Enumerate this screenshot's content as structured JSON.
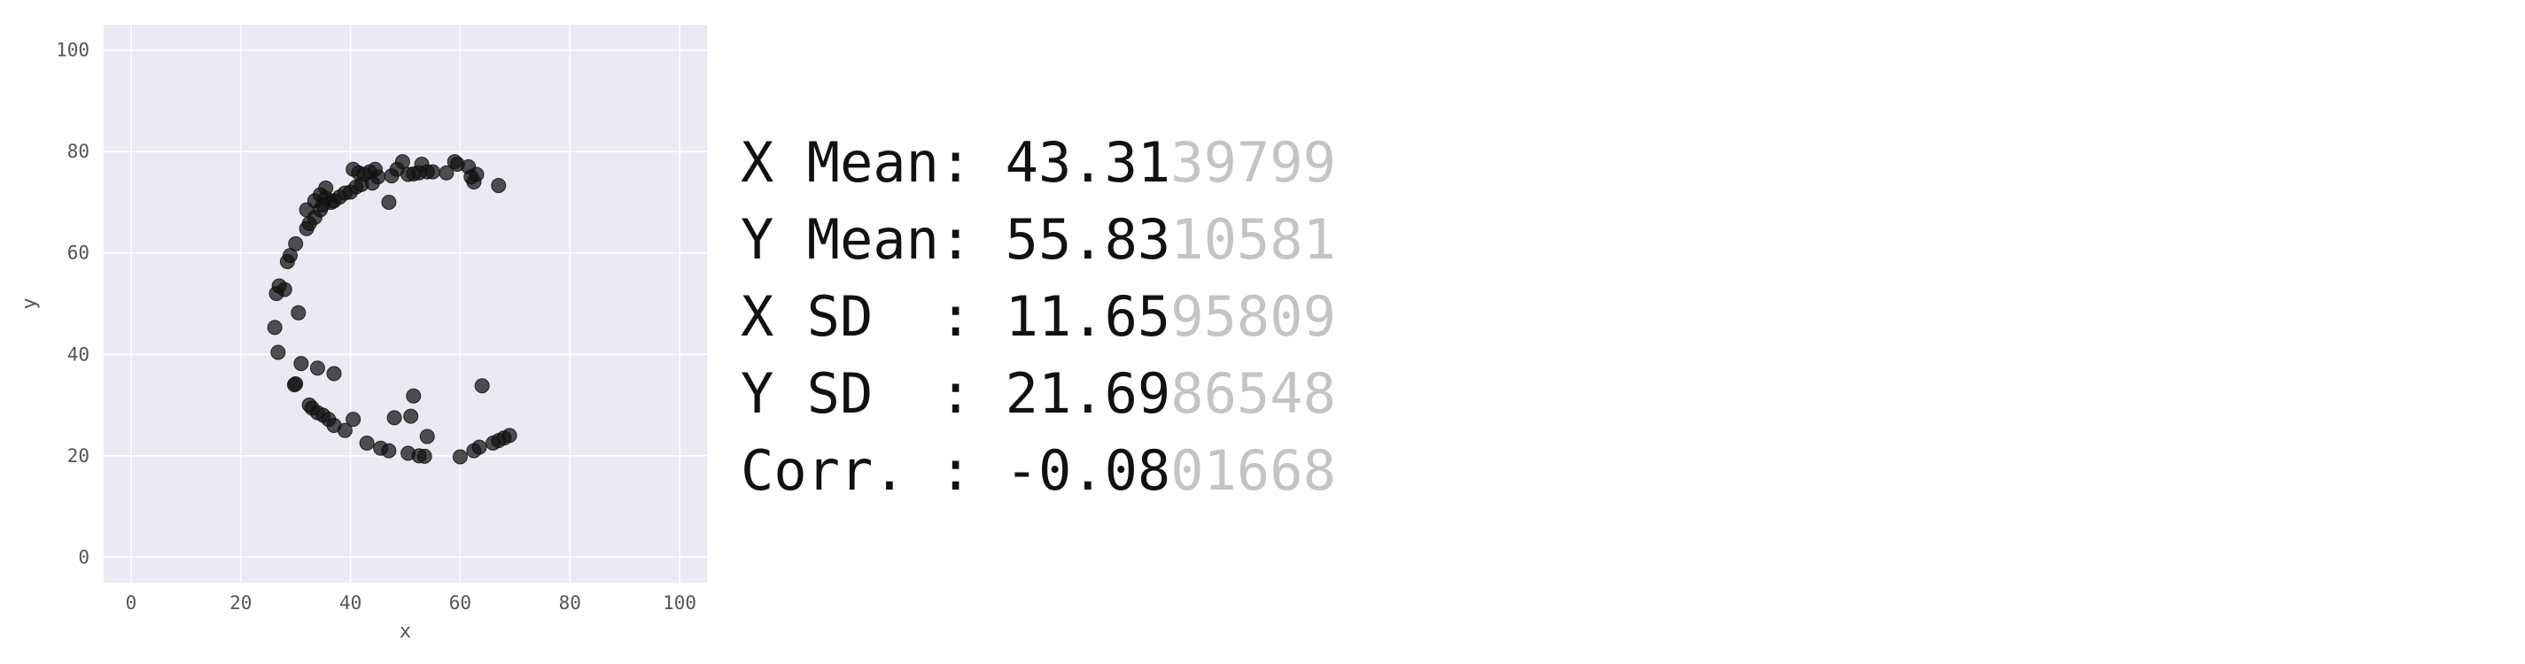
{
  "chart_data": {
    "type": "scatter",
    "xlabel": "x",
    "ylabel": "y",
    "xlim": [
      -5,
      105
    ],
    "ylim": [
      -5,
      105
    ],
    "xticks": [
      0,
      20,
      40,
      60,
      80,
      100
    ],
    "yticks": [
      0,
      20,
      40,
      60,
      80,
      100
    ],
    "grid": true,
    "background": "#eaeaf2",
    "point_color": "#111111",
    "points": [
      [
        26.5,
        52.0
      ],
      [
        27.0,
        53.5
      ],
      [
        28.0,
        52.8
      ],
      [
        28.5,
        58.3
      ],
      [
        29.0,
        59.5
      ],
      [
        30.0,
        61.8
      ],
      [
        26.2,
        45.3
      ],
      [
        30.5,
        48.2
      ],
      [
        26.8,
        40.4
      ],
      [
        29.8,
        34.0
      ],
      [
        30.0,
        34.2
      ],
      [
        31.0,
        38.2
      ],
      [
        34.0,
        37.3
      ],
      [
        37.0,
        36.2
      ],
      [
        32.5,
        30.0
      ],
      [
        33.0,
        29.4
      ],
      [
        34.0,
        28.5
      ],
      [
        35.0,
        28.0
      ],
      [
        36.0,
        27.2
      ],
      [
        37.0,
        26.0
      ],
      [
        39.0,
        25.0
      ],
      [
        40.5,
        27.2
      ],
      [
        43.0,
        22.5
      ],
      [
        45.5,
        21.5
      ],
      [
        47.0,
        21.0
      ],
      [
        48.0,
        27.5
      ],
      [
        50.5,
        20.5
      ],
      [
        51.0,
        27.8
      ],
      [
        51.5,
        31.8
      ],
      [
        52.5,
        20.0
      ],
      [
        53.5,
        19.9
      ],
      [
        54.0,
        23.8
      ],
      [
        60.0,
        19.8
      ],
      [
        62.5,
        21.0
      ],
      [
        63.5,
        21.7
      ],
      [
        64.0,
        33.8
      ],
      [
        66.0,
        22.5
      ],
      [
        67.0,
        23.0
      ],
      [
        68.0,
        23.5
      ],
      [
        69.0,
        24.0
      ],
      [
        32.0,
        64.8
      ],
      [
        32.5,
        65.8
      ],
      [
        33.5,
        67.0
      ],
      [
        34.5,
        68.5
      ],
      [
        35.0,
        69.5
      ],
      [
        35.5,
        70.8
      ],
      [
        32.0,
        68.5
      ],
      [
        33.5,
        70.3
      ],
      [
        34.5,
        71.5
      ],
      [
        35.5,
        72.8
      ],
      [
        36.5,
        70.0
      ],
      [
        37.0,
        70.3
      ],
      [
        38.0,
        71.0
      ],
      [
        39.0,
        71.8
      ],
      [
        40.0,
        72.0
      ],
      [
        41.0,
        73.0
      ],
      [
        42.0,
        73.5
      ],
      [
        40.5,
        76.5
      ],
      [
        41.5,
        75.8
      ],
      [
        42.5,
        75.5
      ],
      [
        43.5,
        76.0
      ],
      [
        44.5,
        76.5
      ],
      [
        45.0,
        75.0
      ],
      [
        44.0,
        73.8
      ],
      [
        47.0,
        70.0
      ],
      [
        47.5,
        75.2
      ],
      [
        48.5,
        76.5
      ],
      [
        49.5,
        78.0
      ],
      [
        50.5,
        75.5
      ],
      [
        51.5,
        75.6
      ],
      [
        52.5,
        75.8
      ],
      [
        53.0,
        77.5
      ],
      [
        54.0,
        76.0
      ],
      [
        55.0,
        76.0
      ],
      [
        57.5,
        75.8
      ],
      [
        59.0,
        78.0
      ],
      [
        59.5,
        77.5
      ],
      [
        61.5,
        77.0
      ],
      [
        62.5,
        74.0
      ],
      [
        63.0,
        75.5
      ],
      [
        62.0,
        75.0
      ],
      [
        67.0,
        73.3
      ]
    ]
  },
  "stats": [
    {
      "label": "X Mean: ",
      "shown": "43.31",
      "faded": "39799"
    },
    {
      "label": "Y Mean: ",
      "shown": "55.83",
      "faded": "10581"
    },
    {
      "label": "X SD  : ",
      "shown": "11.65",
      "faded": "95809"
    },
    {
      "label": "Y SD  : ",
      "shown": "21.69",
      "faded": "86548"
    },
    {
      "label": "Corr. : ",
      "shown": "-0.08",
      "faded": "01668"
    }
  ]
}
